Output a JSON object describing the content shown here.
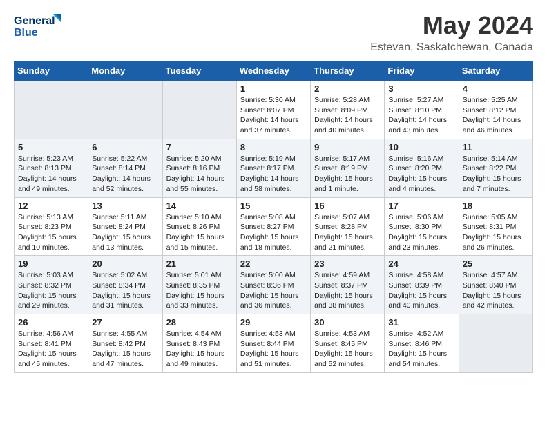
{
  "logo": {
    "line1": "General",
    "line2": "Blue"
  },
  "title": "May 2024",
  "subtitle": "Estevan, Saskatchewan, Canada",
  "days_of_week": [
    "Sunday",
    "Monday",
    "Tuesday",
    "Wednesday",
    "Thursday",
    "Friday",
    "Saturday"
  ],
  "weeks": [
    [
      {
        "day": "",
        "info": ""
      },
      {
        "day": "",
        "info": ""
      },
      {
        "day": "",
        "info": ""
      },
      {
        "day": "1",
        "info": "Sunrise: 5:30 AM\nSunset: 8:07 PM\nDaylight: 14 hours\nand 37 minutes."
      },
      {
        "day": "2",
        "info": "Sunrise: 5:28 AM\nSunset: 8:09 PM\nDaylight: 14 hours\nand 40 minutes."
      },
      {
        "day": "3",
        "info": "Sunrise: 5:27 AM\nSunset: 8:10 PM\nDaylight: 14 hours\nand 43 minutes."
      },
      {
        "day": "4",
        "info": "Sunrise: 5:25 AM\nSunset: 8:12 PM\nDaylight: 14 hours\nand 46 minutes."
      }
    ],
    [
      {
        "day": "5",
        "info": "Sunrise: 5:23 AM\nSunset: 8:13 PM\nDaylight: 14 hours\nand 49 minutes."
      },
      {
        "day": "6",
        "info": "Sunrise: 5:22 AM\nSunset: 8:14 PM\nDaylight: 14 hours\nand 52 minutes."
      },
      {
        "day": "7",
        "info": "Sunrise: 5:20 AM\nSunset: 8:16 PM\nDaylight: 14 hours\nand 55 minutes."
      },
      {
        "day": "8",
        "info": "Sunrise: 5:19 AM\nSunset: 8:17 PM\nDaylight: 14 hours\nand 58 minutes."
      },
      {
        "day": "9",
        "info": "Sunrise: 5:17 AM\nSunset: 8:19 PM\nDaylight: 15 hours\nand 1 minute."
      },
      {
        "day": "10",
        "info": "Sunrise: 5:16 AM\nSunset: 8:20 PM\nDaylight: 15 hours\nand 4 minutes."
      },
      {
        "day": "11",
        "info": "Sunrise: 5:14 AM\nSunset: 8:22 PM\nDaylight: 15 hours\nand 7 minutes."
      }
    ],
    [
      {
        "day": "12",
        "info": "Sunrise: 5:13 AM\nSunset: 8:23 PM\nDaylight: 15 hours\nand 10 minutes."
      },
      {
        "day": "13",
        "info": "Sunrise: 5:11 AM\nSunset: 8:24 PM\nDaylight: 15 hours\nand 13 minutes."
      },
      {
        "day": "14",
        "info": "Sunrise: 5:10 AM\nSunset: 8:26 PM\nDaylight: 15 hours\nand 15 minutes."
      },
      {
        "day": "15",
        "info": "Sunrise: 5:08 AM\nSunset: 8:27 PM\nDaylight: 15 hours\nand 18 minutes."
      },
      {
        "day": "16",
        "info": "Sunrise: 5:07 AM\nSunset: 8:28 PM\nDaylight: 15 hours\nand 21 minutes."
      },
      {
        "day": "17",
        "info": "Sunrise: 5:06 AM\nSunset: 8:30 PM\nDaylight: 15 hours\nand 23 minutes."
      },
      {
        "day": "18",
        "info": "Sunrise: 5:05 AM\nSunset: 8:31 PM\nDaylight: 15 hours\nand 26 minutes."
      }
    ],
    [
      {
        "day": "19",
        "info": "Sunrise: 5:03 AM\nSunset: 8:32 PM\nDaylight: 15 hours\nand 29 minutes."
      },
      {
        "day": "20",
        "info": "Sunrise: 5:02 AM\nSunset: 8:34 PM\nDaylight: 15 hours\nand 31 minutes."
      },
      {
        "day": "21",
        "info": "Sunrise: 5:01 AM\nSunset: 8:35 PM\nDaylight: 15 hours\nand 33 minutes."
      },
      {
        "day": "22",
        "info": "Sunrise: 5:00 AM\nSunset: 8:36 PM\nDaylight: 15 hours\nand 36 minutes."
      },
      {
        "day": "23",
        "info": "Sunrise: 4:59 AM\nSunset: 8:37 PM\nDaylight: 15 hours\nand 38 minutes."
      },
      {
        "day": "24",
        "info": "Sunrise: 4:58 AM\nSunset: 8:39 PM\nDaylight: 15 hours\nand 40 minutes."
      },
      {
        "day": "25",
        "info": "Sunrise: 4:57 AM\nSunset: 8:40 PM\nDaylight: 15 hours\nand 42 minutes."
      }
    ],
    [
      {
        "day": "26",
        "info": "Sunrise: 4:56 AM\nSunset: 8:41 PM\nDaylight: 15 hours\nand 45 minutes."
      },
      {
        "day": "27",
        "info": "Sunrise: 4:55 AM\nSunset: 8:42 PM\nDaylight: 15 hours\nand 47 minutes."
      },
      {
        "day": "28",
        "info": "Sunrise: 4:54 AM\nSunset: 8:43 PM\nDaylight: 15 hours\nand 49 minutes."
      },
      {
        "day": "29",
        "info": "Sunrise: 4:53 AM\nSunset: 8:44 PM\nDaylight: 15 hours\nand 51 minutes."
      },
      {
        "day": "30",
        "info": "Sunrise: 4:53 AM\nSunset: 8:45 PM\nDaylight: 15 hours\nand 52 minutes."
      },
      {
        "day": "31",
        "info": "Sunrise: 4:52 AM\nSunset: 8:46 PM\nDaylight: 15 hours\nand 54 minutes."
      },
      {
        "day": "",
        "info": ""
      }
    ]
  ]
}
